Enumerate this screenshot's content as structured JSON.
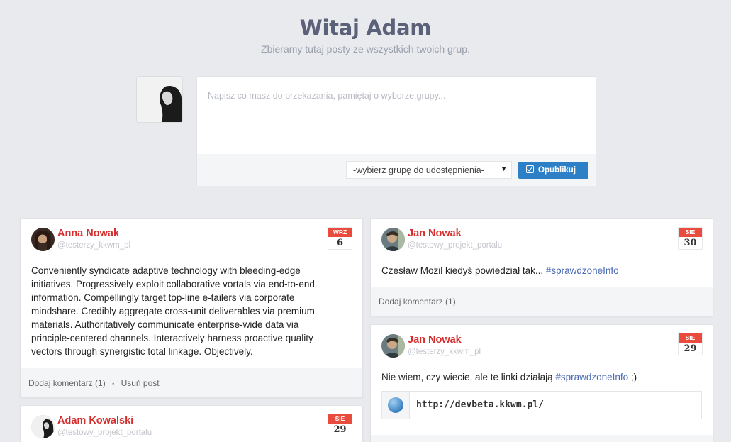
{
  "header": {
    "title": "Witaj Adam",
    "subtitle": "Zbieramy tutaj posty ze wszystkich twoich grup."
  },
  "composer": {
    "placeholder": "Napisz co masz do przekazania, pamiętaj o wyborze grupy...",
    "group_select": "-wybierz grupę do udostępnienia-",
    "publish_label": "Opublikuj"
  },
  "posts": [
    {
      "author": "Anna Nowak",
      "group": "@testerzy_kkwm_pl",
      "month": "WRZ",
      "day": "6",
      "text": "Conveniently syndicate adaptive technology with bleeding-edge initiatives. Progressively exploit collaborative vortals via end-to-end information. Compellingly target top-line e-tailers via corporate mindshare. Credibly aggregate cross-unit deliverables via premium materials. Authoritatively communicate enterprise-wide data via principle-centered channels. Interactively harness proactive quality vectors through synergistic total linkage. Objectively.",
      "comment_label": "Dodaj komentarz (1)",
      "separator": "•",
      "delete_label": "Usuń post"
    },
    {
      "author": "Adam Kowalski",
      "group": "@testowy_projekt_portalu",
      "month": "SIE",
      "day": "29"
    },
    {
      "author": "Jan Nowak",
      "group": "@testowy_projekt_portalu",
      "month": "SIE",
      "day": "30",
      "text": "Czesław Mozil kiedyś powiedział tak... ",
      "hashtag": "#sprawdzoneInfo",
      "comment_label": "Dodaj komentarz (1)"
    },
    {
      "author": "Jan Nowak",
      "group": "@testerzy_kkwm_pl",
      "month": "SIE",
      "day": "29",
      "text": "Nie wiem, czy wiecie, ale te linki działają ",
      "hashtag": "#sprawdzoneInfo",
      "text_after": " ;)",
      "link": "http://devbeta.kkwm.pl/"
    }
  ],
  "colors": {
    "accent": "#d62d2d",
    "button": "#2e80c6",
    "hashtag": "#4b6ab5",
    "date_badge": "#e94c3d"
  }
}
